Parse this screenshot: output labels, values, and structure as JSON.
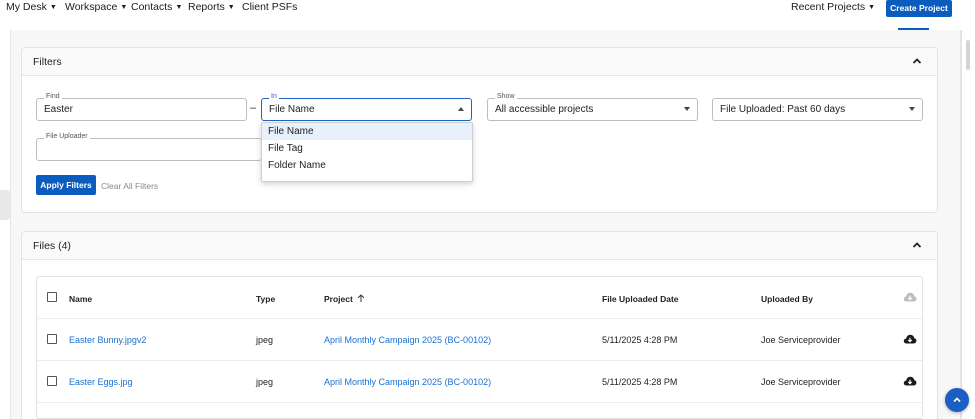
{
  "nav": {
    "items": [
      "My Desk",
      "Workspace",
      "Contacts",
      "Reports"
    ],
    "client_psfs": "Client PSFs",
    "recent_projects": "Recent Projects",
    "create_project": "Create Project"
  },
  "filters": {
    "title": "Filters",
    "find": {
      "label": "Find",
      "value": "Easter"
    },
    "in": {
      "label": "In",
      "value": "File Name",
      "options": [
        "File Name",
        "File Tag",
        "Folder Name"
      ]
    },
    "show": {
      "label": "Show",
      "value": "All accessible projects"
    },
    "uploaded": {
      "value": "File Uploaded: Past 60 days"
    },
    "uploader": {
      "label": "File Uploader",
      "value": ""
    },
    "apply": "Apply Filters",
    "clear": "Clear All Filters"
  },
  "files": {
    "title": "Files (4)",
    "columns": {
      "name": "Name",
      "type": "Type",
      "project": "Project",
      "date": "File Uploaded Date",
      "by": "Uploaded By"
    },
    "rows": [
      {
        "name": "Easter Bunny.jpgv2",
        "type": "jpeg",
        "project": "April Monthly Campaign 2025 (BC-00102)",
        "date": "5/11/2025 4:28 PM",
        "by": "Joe Serviceprovider"
      },
      {
        "name": "Easter Eggs.jpg",
        "type": "jpeg",
        "project": "April Monthly Campaign 2025 (BC-00102)",
        "date": "5/11/2025 4:28 PM",
        "by": "Joe Serviceprovider"
      }
    ]
  },
  "colors": {
    "accent": "#0b5cbf",
    "link": "#1a6fd4"
  }
}
